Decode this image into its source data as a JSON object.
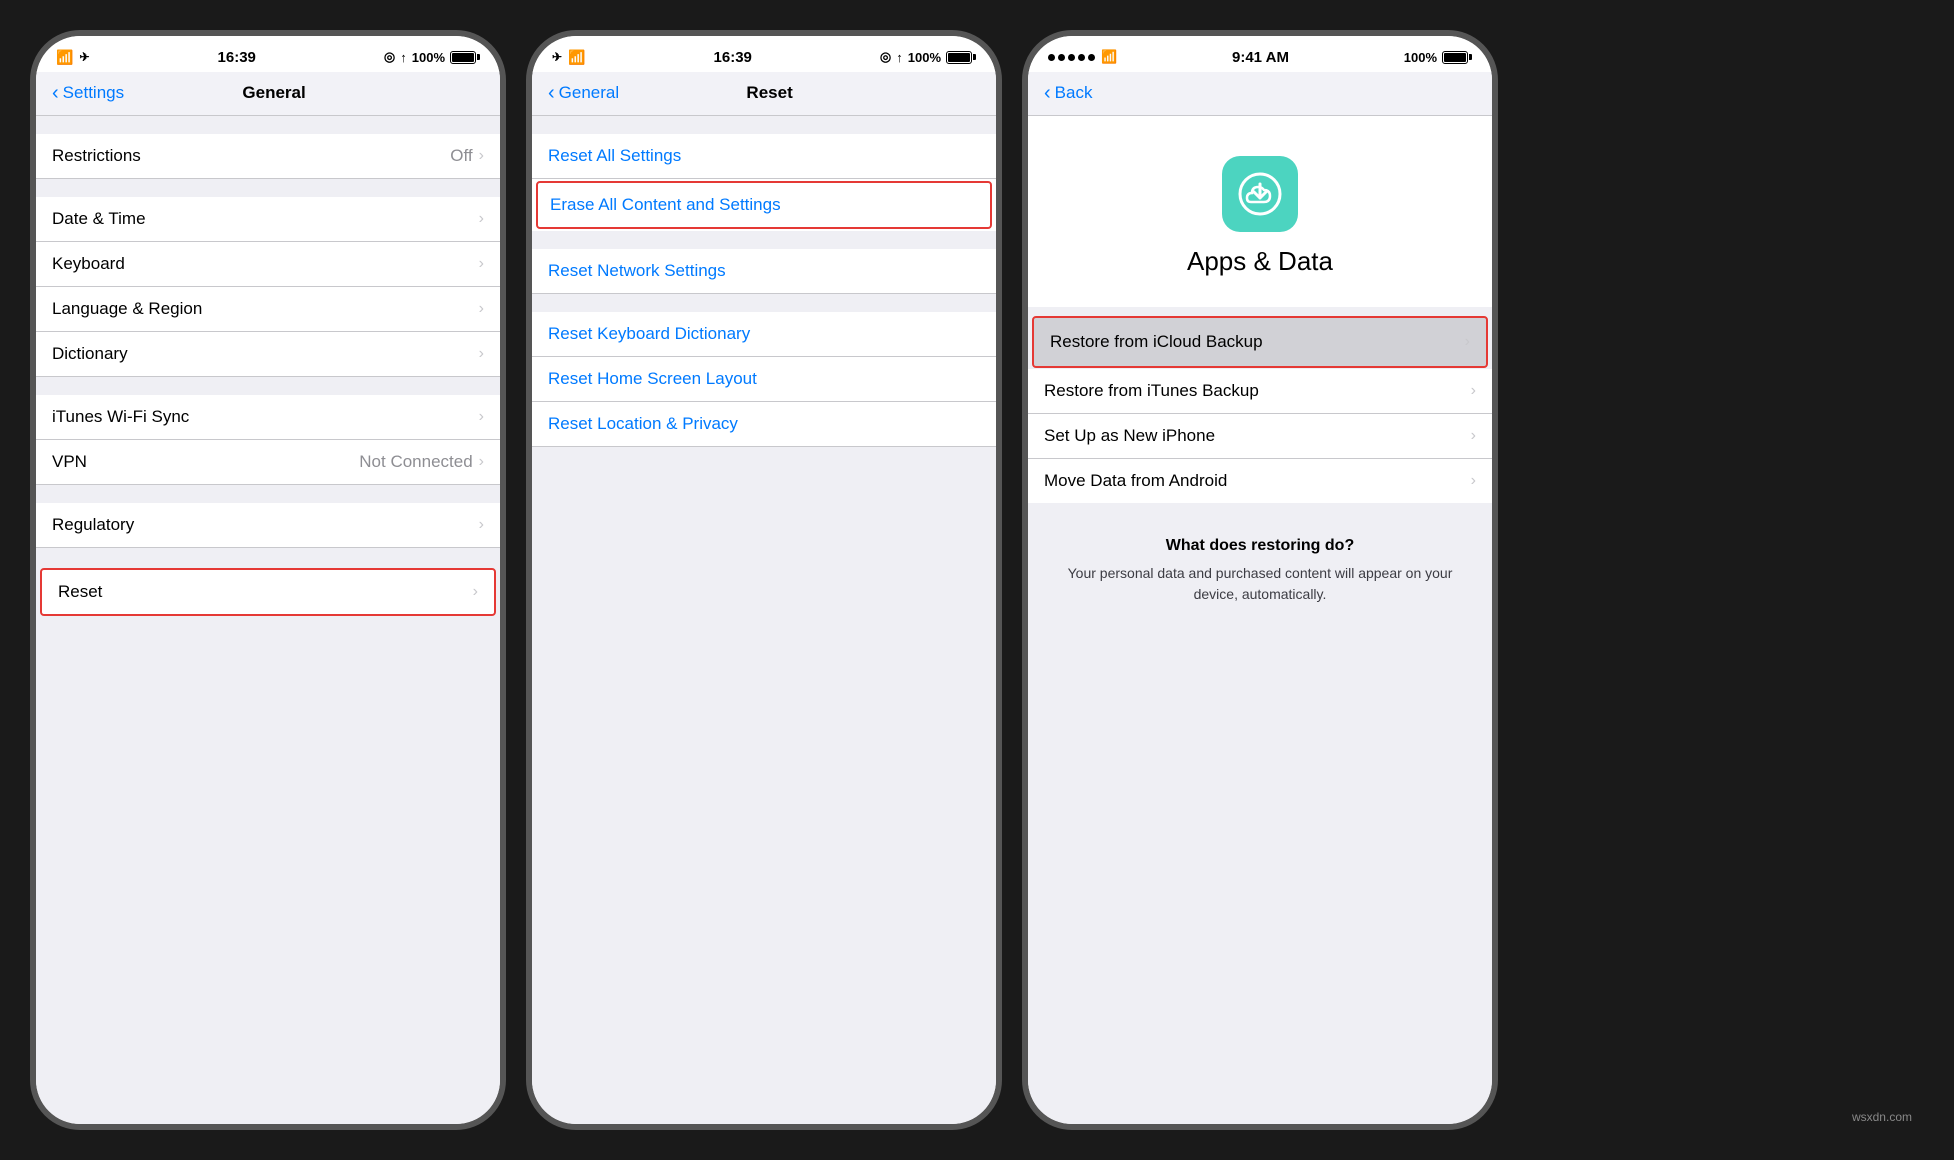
{
  "panel1": {
    "status": {
      "time": "16:39",
      "wifi": "wifi",
      "location": true,
      "battery": "100%"
    },
    "nav": {
      "back_label": "Settings",
      "title": "General"
    },
    "items": [
      {
        "label": "Restrictions",
        "value": "Off",
        "has_chevron": true,
        "red_border": false
      },
      {
        "label": "Date & Time",
        "value": "",
        "has_chevron": true
      },
      {
        "label": "Keyboard",
        "value": "",
        "has_chevron": true
      },
      {
        "label": "Language & Region",
        "value": "",
        "has_chevron": true
      },
      {
        "label": "Dictionary",
        "value": "",
        "has_chevron": true
      },
      {
        "label": "iTunes Wi-Fi Sync",
        "value": "",
        "has_chevron": true
      },
      {
        "label": "VPN",
        "value": "Not Connected",
        "has_chevron": true
      },
      {
        "label": "Regulatory",
        "value": "",
        "has_chevron": true
      },
      {
        "label": "Reset",
        "value": "",
        "has_chevron": true,
        "red_border": true
      }
    ]
  },
  "panel2": {
    "status": {
      "time": "16:39",
      "wifi": "wifi",
      "battery": "100%"
    },
    "nav": {
      "back_label": "General",
      "title": "Reset"
    },
    "items": [
      {
        "label": "Reset All Settings",
        "blue": true,
        "red_border": false
      },
      {
        "label": "Erase All Content and Settings",
        "blue": true,
        "red_border": true
      },
      {
        "label": "Reset Network Settings",
        "blue": true
      },
      {
        "label": "Reset Keyboard Dictionary",
        "blue": true
      },
      {
        "label": "Reset Home Screen Layout",
        "blue": true
      },
      {
        "label": "Reset Location & Privacy",
        "blue": true
      }
    ]
  },
  "panel3": {
    "status": {
      "time": "9:41 AM",
      "signal": 5,
      "wifi": true,
      "battery": "100%"
    },
    "nav": {
      "back_label": "Back"
    },
    "header": {
      "icon_alt": "iCloud restore icon",
      "title": "Apps & Data"
    },
    "options": [
      {
        "label": "Restore from iCloud Backup",
        "highlighted": true,
        "red_border": true
      },
      {
        "label": "Restore from iTunes Backup",
        "highlighted": false
      },
      {
        "label": "Set Up as New iPhone",
        "highlighted": false
      },
      {
        "label": "Move Data from Android",
        "highlighted": false
      }
    ],
    "info": {
      "title": "What does restoring do?",
      "text": "Your personal data and purchased content will appear on your device, automatically."
    }
  },
  "watermark": "wsxdn.com"
}
